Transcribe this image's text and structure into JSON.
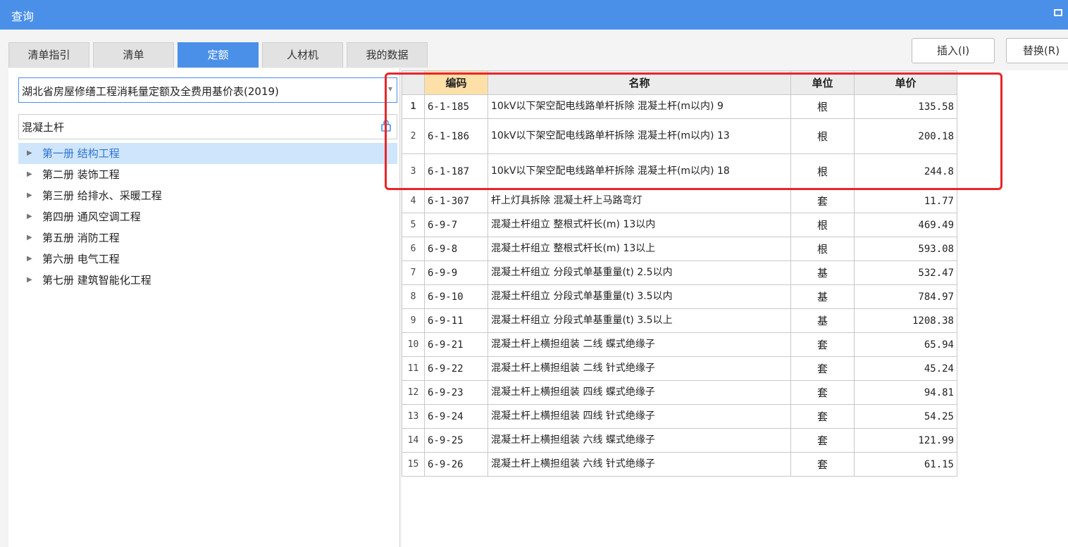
{
  "window": {
    "title": "查询"
  },
  "tabs": [
    {
      "label": "清单指引"
    },
    {
      "label": "清单"
    },
    {
      "label": "定额",
      "active": true
    },
    {
      "label": "人材机"
    },
    {
      "label": "我的数据"
    }
  ],
  "actions": {
    "insert_label": "插入(I)",
    "replace_label": "替换(R)"
  },
  "left": {
    "library": "湖北省房屋修缮工程消耗量定额及全费用基价表(2019)",
    "search_value": "混凝土杆",
    "tree": [
      {
        "label": "第一册 结构工程",
        "selected": true
      },
      {
        "label": "第二册 装饰工程"
      },
      {
        "label": "第三册 给排水、采暖工程"
      },
      {
        "label": "第四册 通风空调工程"
      },
      {
        "label": "第五册 消防工程"
      },
      {
        "label": "第六册 电气工程"
      },
      {
        "label": "第七册 建筑智能化工程"
      }
    ]
  },
  "grid": {
    "headers": {
      "code": "编码",
      "name": "名称",
      "unit": "单位",
      "price": "单价"
    },
    "rows": [
      {
        "n": "1",
        "code": "6-1-185",
        "name": "10kV以下架空配电线路单杆拆除 混凝土杆(m以内) 9",
        "unit": "根",
        "price": "135.58"
      },
      {
        "n": "2",
        "code": "6-1-186",
        "name": "10kV以下架空配电线路单杆拆除 混凝土杆(m以内) 13",
        "unit": "根",
        "price": "200.18"
      },
      {
        "n": "3",
        "code": "6-1-187",
        "name": "10kV以下架空配电线路单杆拆除 混凝土杆(m以内) 18",
        "unit": "根",
        "price": "244.8"
      },
      {
        "n": "4",
        "code": "6-1-307",
        "name": "杆上灯具拆除 混凝土杆上马路弯灯",
        "unit": "套",
        "price": "11.77"
      },
      {
        "n": "5",
        "code": "6-9-7",
        "name": "混凝土杆组立 整根式杆长(m) 13以内",
        "unit": "根",
        "price": "469.49"
      },
      {
        "n": "6",
        "code": "6-9-8",
        "name": "混凝土杆组立 整根式杆长(m) 13以上",
        "unit": "根",
        "price": "593.08"
      },
      {
        "n": "7",
        "code": "6-9-9",
        "name": "混凝土杆组立 分段式单基重量(t) 2.5以内",
        "unit": "基",
        "price": "532.47"
      },
      {
        "n": "8",
        "code": "6-9-10",
        "name": "混凝土杆组立 分段式单基重量(t) 3.5以内",
        "unit": "基",
        "price": "784.97"
      },
      {
        "n": "9",
        "code": "6-9-11",
        "name": "混凝土杆组立 分段式单基重量(t) 3.5以上",
        "unit": "基",
        "price": "1208.38"
      },
      {
        "n": "10",
        "code": "6-9-21",
        "name": "混凝土杆上横担组装 二线 蝶式绝缘子",
        "unit": "套",
        "price": "65.94"
      },
      {
        "n": "11",
        "code": "6-9-22",
        "name": "混凝土杆上横担组装 二线 针式绝缘子",
        "unit": "套",
        "price": "45.24"
      },
      {
        "n": "12",
        "code": "6-9-23",
        "name": "混凝土杆上横担组装 四线 蝶式绝缘子",
        "unit": "套",
        "price": "94.81"
      },
      {
        "n": "13",
        "code": "6-9-24",
        "name": "混凝土杆上横担组装 四线 针式绝缘子",
        "unit": "套",
        "price": "54.25"
      },
      {
        "n": "14",
        "code": "6-9-25",
        "name": "混凝土杆上横担组装 六线 蝶式绝缘子",
        "unit": "套",
        "price": "121.99"
      },
      {
        "n": "15",
        "code": "6-9-26",
        "name": "混凝土杆上横担组装 六线 针式绝缘子",
        "unit": "套",
        "price": "61.15"
      }
    ]
  },
  "colors": {
    "accent": "#4a90e8",
    "highlight": "#e8262a"
  }
}
